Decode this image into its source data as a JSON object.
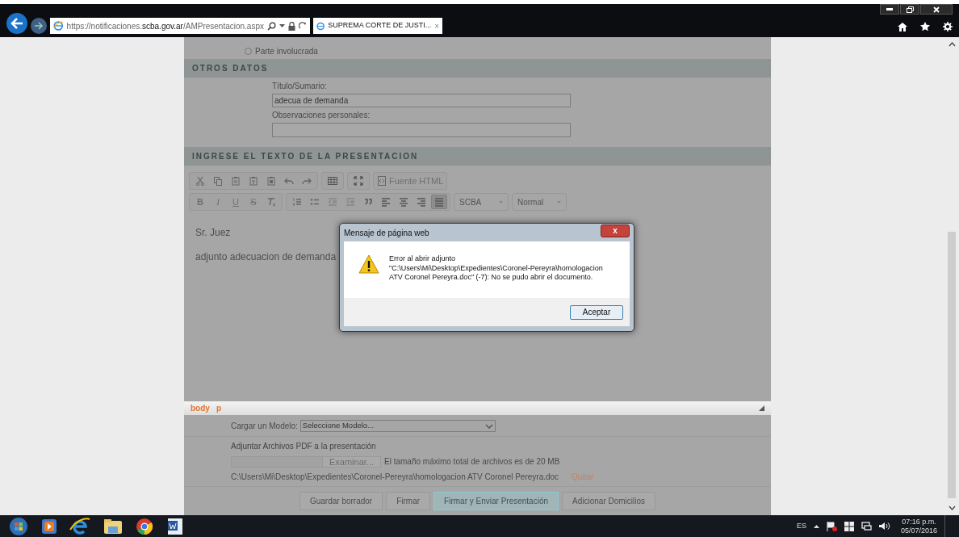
{
  "browser": {
    "url": "https://notificaciones.**scba.gov.ar**/AMPresentacion.aspx",
    "tab_title": "SUPREMA CORTE DE JUSTI...",
    "tab_close": "×"
  },
  "radio_options": [
    {
      "label": "Parte involucrada",
      "selected": false
    }
  ],
  "otros_datos": {
    "title": "OTROS DATOS",
    "fields": [
      {
        "label": "Título/Sumario:",
        "value": "adecua de demanda"
      },
      {
        "label": "Observaciones personales:"
      }
    ]
  },
  "editor": {
    "title": "INGRESE EL TEXTO DE LA PRESENTACION",
    "toolbar_row_1": [
      [
        {
          "kind": "cut"
        },
        {
          "kind": "copy"
        },
        {
          "kind": "paste"
        },
        {
          "kind": "paste-text"
        },
        {
          "kind": "paste-word"
        },
        {
          "kind": "undo"
        },
        {
          "kind": "redo"
        }
      ],
      [
        {
          "kind": "table"
        }
      ],
      [
        {
          "kind": "maximize"
        }
      ],
      [
        {
          "kind": "source",
          "label": "Fuente HTML"
        }
      ]
    ],
    "toolbar_row_2": [
      [
        {
          "kind": "bold",
          "label": "B"
        },
        {
          "kind": "italic",
          "label": "I"
        },
        {
          "kind": "underline",
          "label": "U"
        },
        {
          "kind": "strike",
          "label": "S"
        },
        {
          "kind": "clear-format"
        }
      ],
      [
        {
          "kind": "numbered-list"
        },
        {
          "kind": "bullet-list"
        },
        {
          "kind": "outdent"
        },
        {
          "kind": "indent"
        },
        {
          "kind": "quote"
        },
        {
          "kind": "align-left",
          "selected": false
        },
        {
          "kind": "align-center",
          "selected": false
        },
        {
          "kind": "align-right",
          "selected": false
        },
        {
          "kind": "justify",
          "selected": true
        }
      ]
    ],
    "font": "SCBA",
    "format": "Normal",
    "paragraphs": [
      "Sr. Juez",
      "adjunto adecuacion de demanda"
    ],
    "path": [
      "body",
      "p"
    ]
  },
  "modelo": {
    "label": "Cargar un Modelo:",
    "placeholder": "Seleccione Modelo..."
  },
  "adjuntar": {
    "label": "Adjuntar Archivos PDF a la presentación",
    "browse": "Examinar...",
    "note": "El tamaño máximo total de archivos es de 20 MB",
    "file": "C:\\Users\\Mi\\Desktop\\Expedientes\\Coronel-Pereyra\\homologacion ATV Coronel Pereyra.doc",
    "remove": "Quitar"
  },
  "buttons": [
    {
      "label": "Guardar borrador",
      "primary": false
    },
    {
      "label": "Firmar",
      "primary": false
    },
    {
      "label": "Firmar y Enviar Presentación",
      "primary": true
    },
    {
      "label": "Adicionar Domicilios",
      "primary": false
    }
  ],
  "dialog": {
    "title": "Mensaje de página web",
    "close": "x",
    "message": [
      "Error al abrir adjunto",
      "\"C:\\Users\\Mi\\Desktop\\Expedientes\\Coronel-Pereyra\\homologacion",
      "ATV Coronel Pereyra.doc\" (-7): No se pudo abrir el documento."
    ],
    "button": "Aceptar"
  },
  "taskbar": {
    "language": "ES",
    "time": "07:16 p.m.",
    "date": "05/07/2016"
  }
}
